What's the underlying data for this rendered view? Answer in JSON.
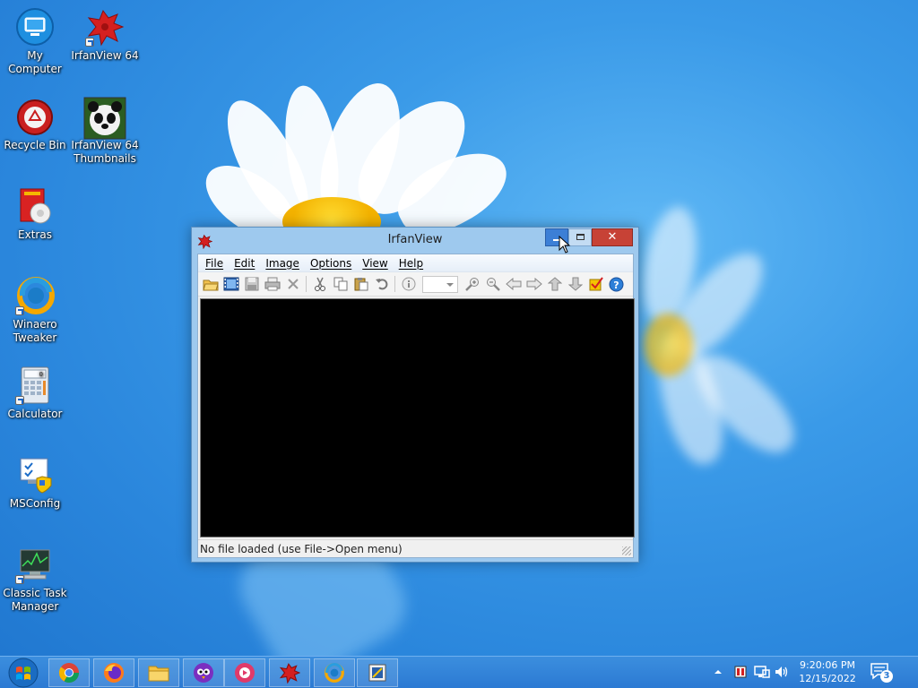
{
  "desktop": {
    "icons": [
      {
        "label": "My Computer"
      },
      {
        "label": "IrfanView 64"
      },
      {
        "label": "Recycle Bin"
      },
      {
        "label": "IrfanView 64 Thumbnails"
      },
      {
        "label": "Extras"
      },
      {
        "label": "Winaero Tweaker"
      },
      {
        "label": "Calculator"
      },
      {
        "label": "MSConfig"
      },
      {
        "label": "Classic Task Manager"
      }
    ]
  },
  "window": {
    "title": "IrfanView",
    "menu": [
      {
        "label": "File"
      },
      {
        "label": "Edit"
      },
      {
        "label": "Image"
      },
      {
        "label": "Options"
      },
      {
        "label": "View"
      },
      {
        "label": "Help"
      }
    ],
    "toolbar_icons": [
      "open-icon",
      "slideshow-icon",
      "save-icon",
      "print-icon",
      "delete-icon",
      "cut-icon",
      "copy-icon",
      "paste-icon",
      "undo-icon",
      "info-icon",
      "zoom-in-icon",
      "zoom-out-icon",
      "previous-icon",
      "next-icon",
      "prev-folder-icon",
      "next-folder-icon",
      "settings-icon",
      "help-icon"
    ],
    "status": "No file loaded (use File->Open menu)"
  },
  "taskbar": {
    "apps": [
      "chrome",
      "firefox",
      "file-explorer",
      "app-bird",
      "app-media",
      "irfanview",
      "winaero-tweaker",
      "sticky-notes"
    ],
    "clock": {
      "time": "9:20:06 PM",
      "date": "12/15/2022"
    },
    "notification_count": "3"
  },
  "colors": {
    "desktop_bg": "#2a86dc",
    "taskbar": "#2c7ad3",
    "close_button": "#c74236",
    "minimize_hover": "#3c7fd6"
  }
}
